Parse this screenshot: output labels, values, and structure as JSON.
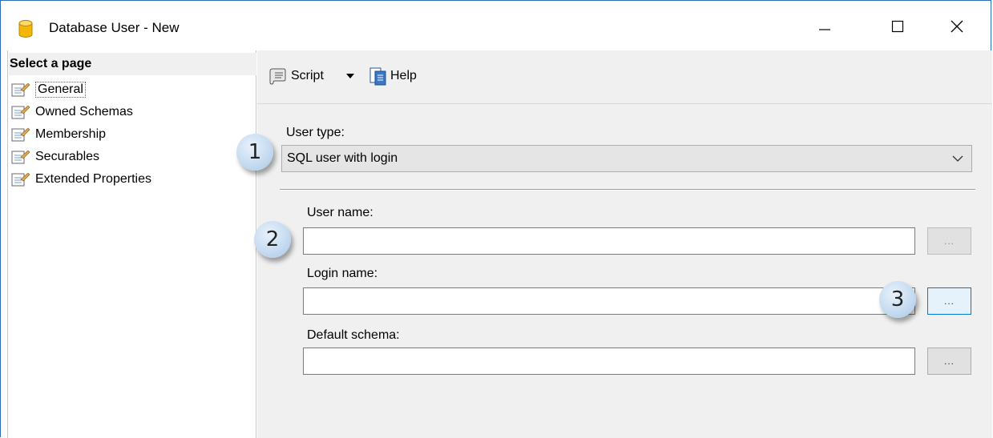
{
  "window": {
    "title": "Database User - New"
  },
  "sidebar": {
    "header": "Select a page",
    "items": [
      {
        "label": "General",
        "selected": true
      },
      {
        "label": "Owned Schemas"
      },
      {
        "label": "Membership"
      },
      {
        "label": "Securables"
      },
      {
        "label": "Extended Properties"
      }
    ]
  },
  "toolbar": {
    "script_label": "Script",
    "help_label": "Help"
  },
  "form": {
    "user_type_label": "User type:",
    "user_type_value": "SQL user with login",
    "user_name_label": "User name:",
    "user_name_value": "",
    "login_name_label": "Login name:",
    "login_name_value": "",
    "default_schema_label": "Default schema:",
    "default_schema_value": "",
    "browse_label": "..."
  },
  "callouts": [
    "1",
    "2",
    "3"
  ],
  "colors": {
    "accent": "#0078d7",
    "panel": "#f0f0f0",
    "callout": "#c7dcf1"
  }
}
